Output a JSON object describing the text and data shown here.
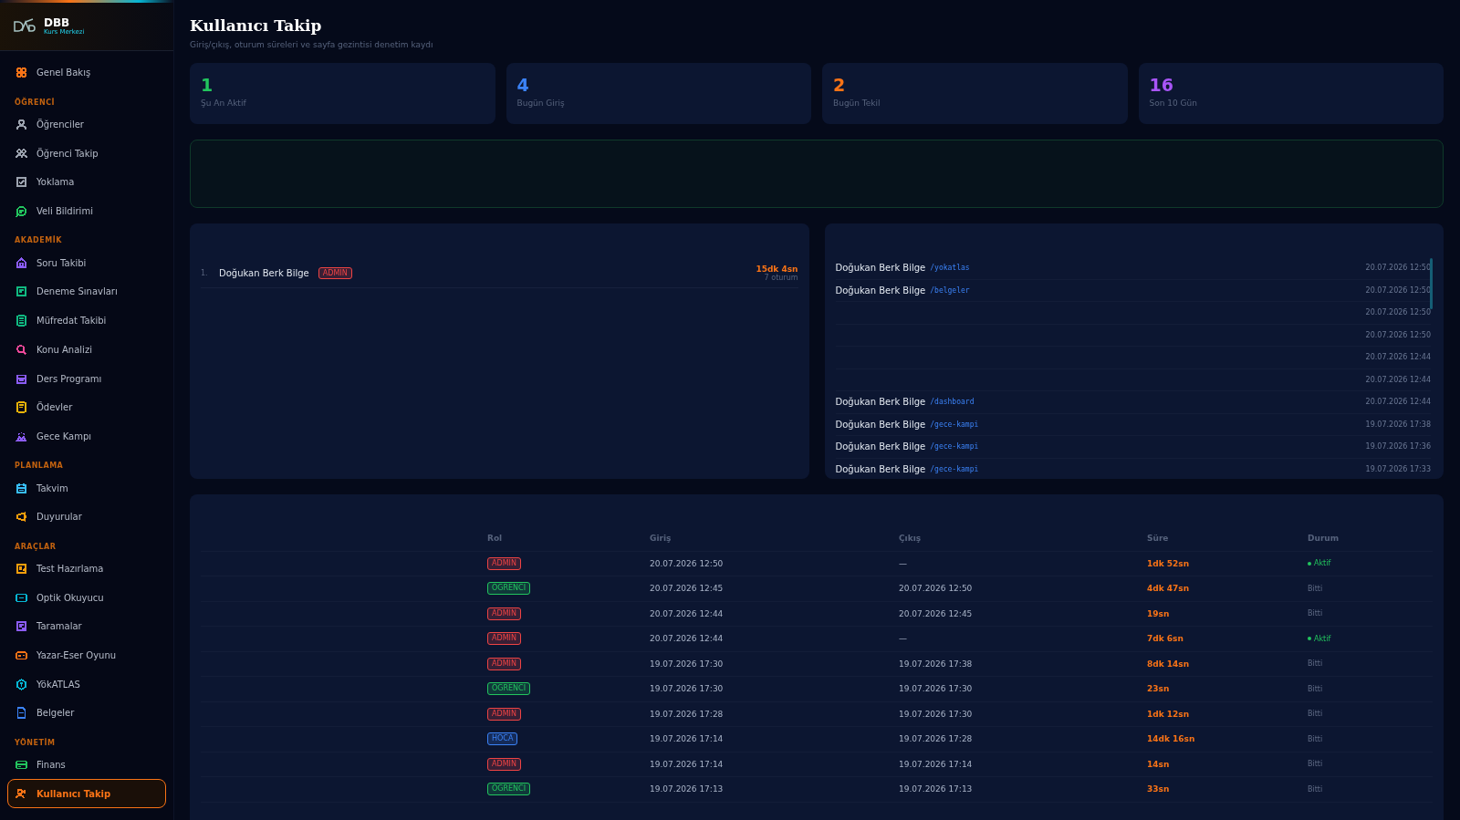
{
  "sidebar": {
    "brand": {
      "title": "DBB",
      "subtitle": "Kurs Merkezi"
    },
    "sections": [
      {
        "items": [
          {
            "label": "Genel Bakış",
            "color": "#f97316",
            "selected": false
          }
        ]
      },
      {
        "heading": "ÖĞRENCİ",
        "items": [
          {
            "label": "Öğrenciler",
            "color": "#9ca3af",
            "selected": false
          },
          {
            "label": "Öğrenci Takip",
            "color": "#9ca3af",
            "selected": false
          },
          {
            "label": "Yoklama",
            "color": "#9ca3af",
            "selected": false
          },
          {
            "label": "Veli Bildirimi",
            "color": "#22c55e",
            "selected": false
          }
        ]
      },
      {
        "heading": "AKADEMİK",
        "items": [
          {
            "label": "Soru Takibi",
            "color": "#8b5cf6",
            "selected": false
          },
          {
            "label": "Deneme Sınavları",
            "color": "#10b981",
            "selected": false
          },
          {
            "label": "Müfredat Takibi",
            "color": "#10b981",
            "selected": false
          },
          {
            "label": "Konu Analizi",
            "color": "#ec4899",
            "selected": false
          },
          {
            "label": "Ders Programı",
            "color": "#8b5cf6",
            "selected": false
          },
          {
            "label": "Ödevler",
            "color": "#eab308",
            "selected": false
          },
          {
            "label": "Gece Kampı",
            "color": "#8b5cf6",
            "selected": false
          }
        ]
      },
      {
        "heading": "PLANLAMA",
        "items": [
          {
            "label": "Takvim",
            "color": "#38bdf8",
            "selected": false
          },
          {
            "label": "Duyurular",
            "color": "#f59e0b",
            "selected": false
          }
        ]
      },
      {
        "heading": "ARAÇLAR",
        "items": [
          {
            "label": "Test Hazırlama",
            "color": "#f59e0b",
            "selected": false
          },
          {
            "label": "Optik Okuyucu",
            "color": "#06b6d4",
            "selected": false
          },
          {
            "label": "Taramalar",
            "color": "#8b5cf6",
            "selected": false
          },
          {
            "label": "Yazar-Eser Oyunu",
            "color": "#f97316",
            "selected": false
          },
          {
            "label": "YökATLAS",
            "color": "#06b6d4",
            "selected": false
          },
          {
            "label": "Belgeler",
            "color": "#3b82f6",
            "selected": false
          }
        ]
      },
      {
        "heading": "YÖNETİM",
        "items": [
          {
            "label": "Finans",
            "color": "#22c55e",
            "selected": false
          },
          {
            "label": "Kullanıcı Takip",
            "color": "#f97316",
            "selected": true
          }
        ]
      }
    ]
  },
  "header": {
    "title": "Kullanıcı Takip",
    "subtitle": "Giriş/çıkış, oturum süreleri ve sayfa gezintisi denetim kaydı"
  },
  "stats": [
    {
      "value": "1",
      "label": "Şu An Aktif",
      "color": "#22c55e"
    },
    {
      "value": "4",
      "label": "Bugün Giriş",
      "color": "#3b82f6"
    },
    {
      "value": "2",
      "label": "Bugün Tekil",
      "color": "#f97316"
    },
    {
      "value": "16",
      "label": "Son 10 Gün",
      "color": "#a855f7"
    }
  ],
  "ranking": {
    "rows": [
      {
        "index": "1.",
        "name": "Doğukan Berk Bilge",
        "role": {
          "label": "ADMIN",
          "color": "#ef4444"
        },
        "duration": "15dk 4sn",
        "sessions": "7 oturum"
      }
    ]
  },
  "page_visits": {
    "rows": [
      {
        "user": "Doğukan Berk Bilge",
        "path": "/yokatlas",
        "time": "20.07.2026 12:50"
      },
      {
        "user": "Doğukan Berk Bilge",
        "path": "/belgeler",
        "time": "20.07.2026 12:50"
      },
      {
        "time": "20.07.2026 12:50"
      },
      {
        "time": "20.07.2026 12:50"
      },
      {
        "time": "20.07.2026 12:44"
      },
      {
        "time": "20.07.2026 12:44"
      },
      {
        "user": "Doğukan Berk Bilge",
        "path": "/dashboard",
        "time": "20.07.2026 12:44"
      },
      {
        "user": "Doğukan Berk Bilge",
        "path": "/gece-kampi",
        "time": "19.07.2026 17:38"
      },
      {
        "user": "Doğukan Berk Bilge",
        "path": "/gece-kampi",
        "time": "19.07.2026 17:36"
      },
      {
        "user": "Doğukan Berk Bilge",
        "path": "/gece-kampi",
        "time": "19.07.2026 17:33"
      }
    ]
  },
  "sessions": {
    "columns": [
      "Rol",
      "Giriş",
      "Çıkış",
      "Süre",
      "Durum"
    ],
    "rows": [
      {
        "role": {
          "label": "ADMIN",
          "color": "#ef4444"
        },
        "login": "20.07.2026 12:50",
        "logout": "—",
        "duration": "1dk 52sn",
        "status": "Aktif",
        "active": true
      },
      {
        "role": {
          "label": "OGRENCI",
          "color": "#22c55e"
        },
        "login": "20.07.2026 12:45",
        "logout": "20.07.2026 12:50",
        "duration": "4dk 47sn",
        "status": "Bitti",
        "active": false
      },
      {
        "role": {
          "label": "ADMIN",
          "color": "#ef4444"
        },
        "login": "20.07.2026 12:44",
        "logout": "20.07.2026 12:45",
        "duration": "19sn",
        "status": "Bitti",
        "active": false
      },
      {
        "role": {
          "label": "ADMIN",
          "color": "#ef4444"
        },
        "login": "20.07.2026 12:44",
        "logout": "—",
        "duration": "7dk 6sn",
        "status": "Aktif",
        "active": true
      },
      {
        "role": {
          "label": "ADMIN",
          "color": "#ef4444"
        },
        "login": "19.07.2026 17:30",
        "logout": "19.07.2026 17:38",
        "duration": "8dk 14sn",
        "status": "Bitti",
        "active": false
      },
      {
        "role": {
          "label": "OGRENCI",
          "color": "#22c55e"
        },
        "login": "19.07.2026 17:30",
        "logout": "19.07.2026 17:30",
        "duration": "23sn",
        "status": "Bitti",
        "active": false
      },
      {
        "role": {
          "label": "ADMIN",
          "color": "#ef4444"
        },
        "login": "19.07.2026 17:28",
        "logout": "19.07.2026 17:30",
        "duration": "1dk 12sn",
        "status": "Bitti",
        "active": false
      },
      {
        "role": {
          "label": "HOCA",
          "color": "#3b82f6"
        },
        "login": "19.07.2026 17:14",
        "logout": "19.07.2026 17:28",
        "duration": "14dk 16sn",
        "status": "Bitti",
        "active": false
      },
      {
        "role": {
          "label": "ADMIN",
          "color": "#ef4444"
        },
        "login": "19.07.2026 17:14",
        "logout": "19.07.2026 17:14",
        "duration": "14sn",
        "status": "Bitti",
        "active": false
      },
      {
        "role": {
          "label": "OGRENCI",
          "color": "#22c55e"
        },
        "login": "19.07.2026 17:13",
        "logout": "19.07.2026 17:13",
        "duration": "33sn",
        "status": "Bitti",
        "active": false
      }
    ]
  }
}
